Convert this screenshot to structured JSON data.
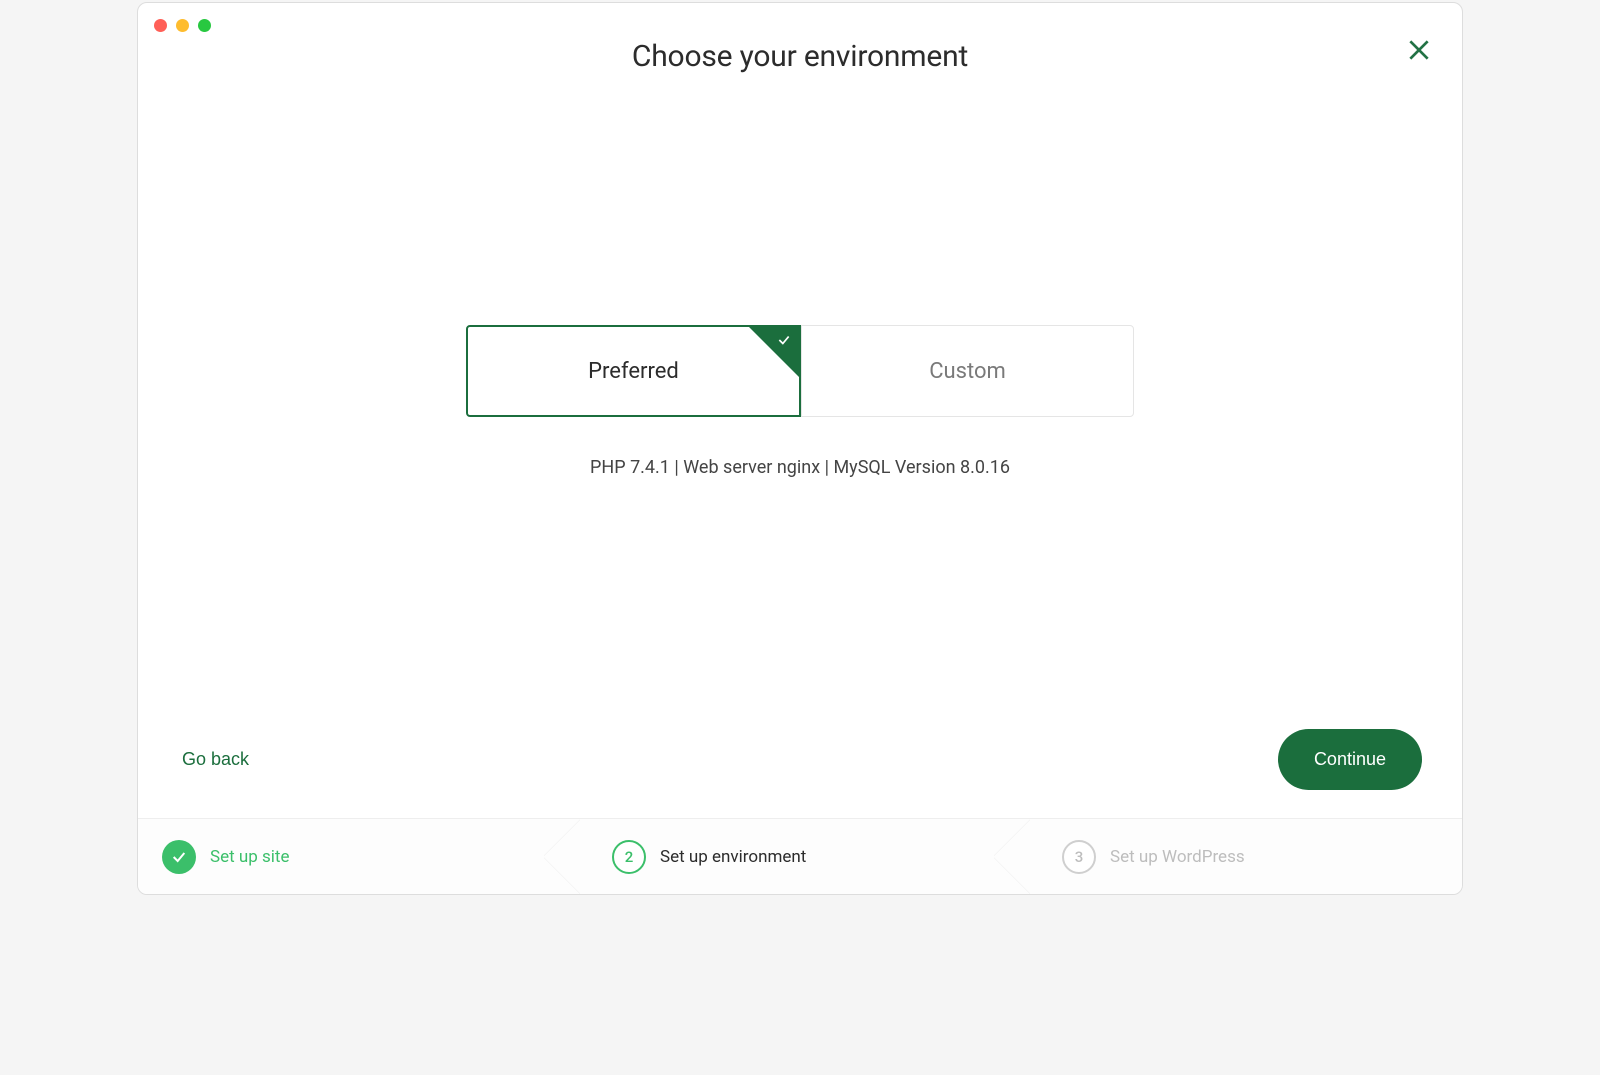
{
  "header": {
    "title": "Choose your environment"
  },
  "options": {
    "preferred": {
      "label": "Preferred",
      "selected": true
    },
    "custom": {
      "label": "Custom",
      "selected": false
    }
  },
  "env_summary": "PHP 7.4.1 | Web server nginx | MySQL Version 8.0.16",
  "actions": {
    "back": "Go back",
    "continue": "Continue"
  },
  "stepper": {
    "steps": [
      {
        "num": "✓",
        "label": "Set up site",
        "state": "done"
      },
      {
        "num": "2",
        "label": "Set up environment",
        "state": "current"
      },
      {
        "num": "3",
        "label": "Set up WordPress",
        "state": "upcoming"
      }
    ]
  },
  "colors": {
    "accent": "#1b6e3d",
    "accent_light": "#3bbf6a"
  }
}
